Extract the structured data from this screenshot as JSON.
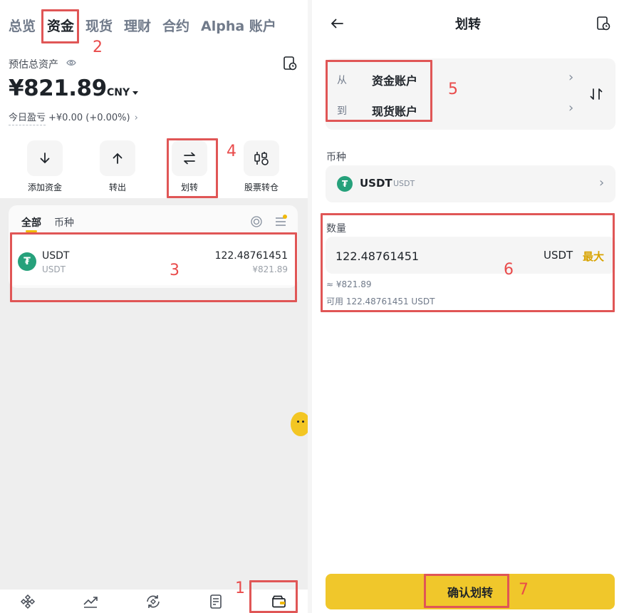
{
  "left": {
    "tabs": [
      "总览",
      "资金",
      "现货",
      "理财",
      "合约",
      "Alpha 账户"
    ],
    "active_tab": "资金",
    "estimated_label": "预估总资产",
    "balance": "¥821.89",
    "currency": "CNY",
    "pnl_label": "今日盈亏",
    "pnl_value": "+¥0.00 (+0.00%)",
    "actions": [
      "添加资金",
      "转出",
      "划转",
      "股票转仓"
    ],
    "subtabs": [
      "全部",
      "币种"
    ],
    "asset": {
      "name": "USDT",
      "sub": "USDT",
      "amount": "122.48761451",
      "value": "¥821.89"
    }
  },
  "right": {
    "title": "划转",
    "from_label": "从",
    "from_value": "资金账户",
    "to_label": "到",
    "to_value": "现货账户",
    "coin_section": "币种",
    "coin_name": "USDT",
    "coin_sub": "USDT",
    "amount_section": "数量",
    "amount_value": "122.48761451",
    "amount_unit": "USDT",
    "max_label": "最大",
    "approx": "≈ ¥821.89",
    "available": "可用 122.48761451 USDT",
    "confirm_label": "确认划转"
  },
  "annotations": [
    "1",
    "2",
    "3",
    "4",
    "5",
    "6",
    "7"
  ],
  "colors": {
    "accent_yellow": "#f0c72b",
    "max_yellow": "#d8a300",
    "annotation_red": "#e05656",
    "usdt_green": "#26a17b"
  }
}
